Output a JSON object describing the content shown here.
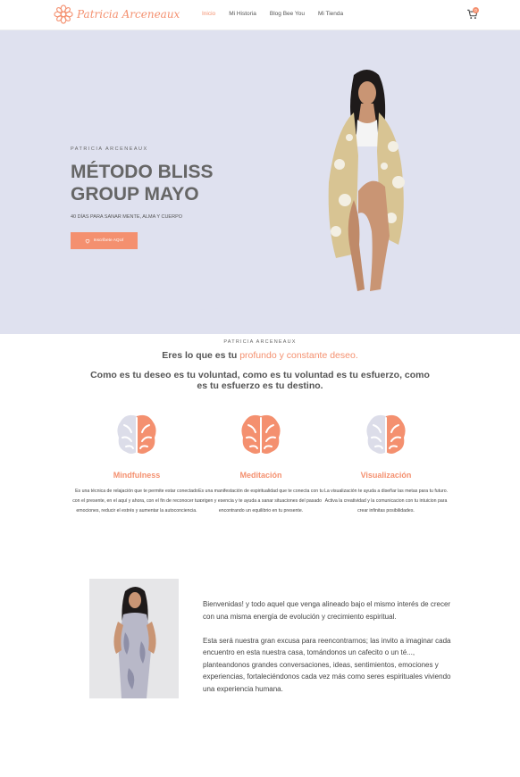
{
  "brand": {
    "name": "Patricia Arceneaux",
    "accent": "#f4906f",
    "hero_bg": "#dfe1ef"
  },
  "nav": {
    "items": [
      {
        "label": "Inicio",
        "active": true
      },
      {
        "label": "Mi Historia",
        "active": false
      },
      {
        "label": "Blog Bee You",
        "active": false
      },
      {
        "label": "Mi Tienda",
        "active": false
      }
    ],
    "cart_icon": "cart-icon",
    "cart_count": "0"
  },
  "hero": {
    "eyebrow": "PATRICIA ARCENEAUX",
    "title": "MÉTODO BLISS GROUP MAYO",
    "subtitle": "40 DÍAS PARA SANAR MENTE, ALMA Y CUERPO",
    "button_label": "Inscríbete AQUÍ",
    "button_icon": "heart-icon"
  },
  "quote": {
    "eyebrow": "PATRICIA ARCENEAUX",
    "line1_prefix": "Eres lo que es tu",
    "line1_highlight": "profundo y constante deseo.",
    "line2": "Como es tu deseo es tu voluntad, como es tu voluntad es tu esfuerzo, como es tu esfuerzo es tu destino."
  },
  "features": [
    {
      "icon": "brain-icon",
      "title": "Mindfulness",
      "text": "Es una técnica de relajación que te permite estar conectado con el presente, en el aquí y ahora, con el fin de reconocer tus emociones, reducir el estrés y aumentar la autoconciencia."
    },
    {
      "icon": "brain-icon",
      "title": "Meditación",
      "text": "Es una manifestación de espiritualidad que te conecta con tu origen y esencia y te ayuda a sanar situaciones del pasado encontrando un equilibrio en tu presente."
    },
    {
      "icon": "brain-icon",
      "title": "Visualización",
      "text": "La visualización te ayuda a diseñar las metas para tu futuro. Activa la creatividad y la comunicacion con tu intuicion para crear infinitas posibilidades."
    }
  ],
  "welcome": {
    "p1": "Bienvenidas! y todo aquel que venga alineado bajo el mismo interés de crecer con una misma energía de evolución y crecimiento espiritual.",
    "p2": "Esta será nuestra gran excusa para reencontrarnos; las invito a imaginar cada encuentro en esta nuestra casa, tomándonos un cafecito o un té..., planteandonos grandes conversaciones, ideas, sentimientos, emociones y experiencias, fortaleciéndonos cada vez más como seres espirituales viviendo una experiencia humana."
  }
}
